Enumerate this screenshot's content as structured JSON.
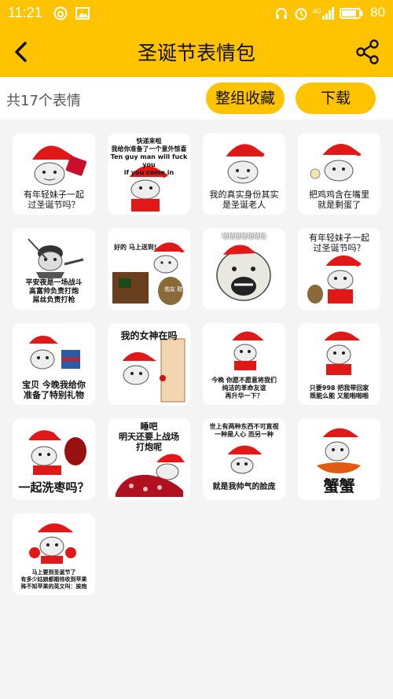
{
  "status": {
    "time": "11:21",
    "battery": "80",
    "network": "4G"
  },
  "header": {
    "title": "圣诞节表情包"
  },
  "toolbar": {
    "count_text": "共17个表情",
    "collect_label": "整组收藏",
    "download_label": "下载"
  },
  "stickers": [
    {
      "caption": "有年轻妹子一起\n过圣诞节吗？"
    },
    {
      "caption": "快递来啦\n我给你准备了一个意外惊喜\nTen guy man will fuck you\nif you come in"
    },
    {
      "caption": "我的真实身份其实\n是圣诞老人"
    },
    {
      "caption": "把鸡鸡含在嘴里\n就是剩蛋了"
    },
    {
      "caption": "平安夜是一场战斗\n高富帅负责打炮\n屌丝负责打枪"
    },
    {
      "caption": "好的 马上送到!",
      "bag_text": "炮友 鞋袜"
    },
    {
      "caption": "哈哈哈哈哈哈哈"
    },
    {
      "caption": "有年轻妹子一起\n过圣诞节吗？"
    },
    {
      "caption": "宝贝 今晚我给你\n准备了特别礼物"
    },
    {
      "caption": "我的女神在吗"
    },
    {
      "caption": "今晚 你愿不愿意将我们\n纯洁的革命友谊\n再升华一下？"
    },
    {
      "caption": "只要998 把我带回家\n既能么能 又能啪啪啪"
    },
    {
      "caption": "一起洗枣吗？"
    },
    {
      "caption": "睡吧\n明天还要上战场\n打炮呢"
    },
    {
      "caption": "世上有两种东西不可直视\n一种是人心 而另一种",
      "caption2": "就是我帅气的脸庞"
    },
    {
      "caption": "蟹蟹"
    },
    {
      "caption": "马上要到圣诞节了\n有多少姑娘都期待收到苹果\n殊不知苹果的英文叫：挨炮"
    }
  ],
  "colors": {
    "accent": "#ffc300",
    "santa_red": "#e01818"
  }
}
